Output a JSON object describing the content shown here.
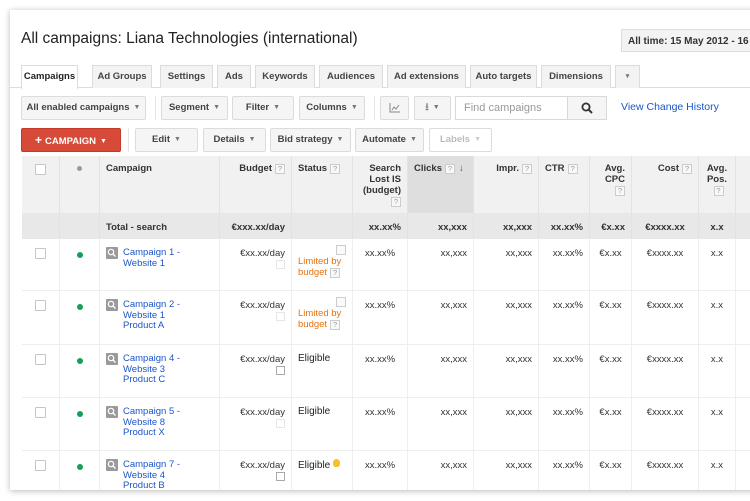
{
  "page": {
    "title": "All campaigns: Liana Technologies (international)",
    "date_range": "All time: 15 May 2012 - 16"
  },
  "tabs": [
    {
      "label": "Campaigns",
      "active": true
    },
    {
      "label": "Ad Groups"
    },
    {
      "label": "Settings"
    },
    {
      "label": "Ads"
    },
    {
      "label": "Keywords"
    },
    {
      "label": "Audiences"
    },
    {
      "label": "Ad extensions"
    },
    {
      "label": "Auto targets"
    },
    {
      "label": "Dimensions"
    },
    {
      "label": "▾",
      "icon": "more-tabs-caret-icon"
    }
  ],
  "toolbar1": {
    "filter_select": "All enabled campaigns",
    "segment": "Segment",
    "filter": "Filter",
    "columns": "Columns",
    "chart_icon": "line-chart-icon",
    "download_icon": "download-icon",
    "search_placeholder": "Find campaigns",
    "search_icon": "search-icon",
    "view_change_history": "View Change History"
  },
  "toolbar2": {
    "add_campaign": "CAMPAIGN",
    "edit": "Edit",
    "details": "Details",
    "bid_strategy": "Bid strategy",
    "automate": "Automate",
    "labels": "Labels"
  },
  "table": {
    "headers": {
      "campaign": "Campaign",
      "budget": "Budget",
      "status": "Status",
      "search_lost_is_1": "Search",
      "search_lost_is_2": "Lost IS",
      "search_lost_is_3": "(budget)",
      "clicks": "Clicks",
      "impr": "Impr.",
      "ctr": "CTR",
      "avg_cpc_1": "Avg.",
      "avg_cpc_2": "CPC",
      "cost": "Cost",
      "avg_pos_1": "Avg.",
      "avg_pos_2": "Pos.",
      "help": "?",
      "sort_arrow": "↓"
    },
    "total": {
      "label": "Total - search",
      "budget": "€xxx.xx/day",
      "search_lost_is": "xx.xx%",
      "clicks": "xx,xxx",
      "impr": "xx,xxx",
      "ctr": "xx.xx%",
      "avg_cpc": "€x.xx",
      "cost": "€xxxx.xx",
      "avg_pos": "x.x"
    },
    "rows": [
      {
        "name_1": "Campaign 1 -",
        "name_2": "Website 1",
        "name_3": "",
        "budget": "€xx.xx/day",
        "status_1": "Limited by",
        "status_2": "budget",
        "status_type": "limited",
        "search_lost_is": "xx.xx%",
        "clicks": "xx,xxx",
        "impr": "xx,xxx",
        "ctr": "xx.xx%",
        "avg_cpc": "€x.xx",
        "cost": "€xxxx.xx",
        "avg_pos": "x.x"
      },
      {
        "name_1": "Campaign 2 -",
        "name_2": "Website 1",
        "name_3": "Product A",
        "budget": "€xx.xx/day",
        "status_1": "Limited by",
        "status_2": "budget",
        "status_type": "limited",
        "search_lost_is": "xx.xx%",
        "clicks": "xx,xxx",
        "impr": "xx,xxx",
        "ctr": "xx.xx%",
        "avg_cpc": "€x.xx",
        "cost": "€xxxx.xx",
        "avg_pos": "x.x"
      },
      {
        "name_1": "Campaign 4 -",
        "name_2": "Website 3",
        "name_3": "Product C",
        "budget": "€xx.xx/day",
        "status_1": "Eligible",
        "status_2": "",
        "status_type": "eligible",
        "search_lost_is": "xx.xx%",
        "clicks": "xx,xxx",
        "impr": "xx,xxx",
        "ctr": "xx.xx%",
        "avg_cpc": "€x.xx",
        "cost": "€xxxx.xx",
        "avg_pos": "x.x"
      },
      {
        "name_1": "Campaign 5 -",
        "name_2": "Website 8",
        "name_3": "Product X",
        "budget": "€xx.xx/day",
        "status_1": "Eligible",
        "status_2": "",
        "status_type": "eligible",
        "search_lost_is": "xx.xx%",
        "clicks": "xx,xxx",
        "impr": "xx,xxx",
        "ctr": "xx.xx%",
        "avg_cpc": "€x.xx",
        "cost": "€xxxx.xx",
        "avg_pos": "x.x"
      },
      {
        "name_1": "Campaign 7 -",
        "name_2": "Website 4",
        "name_3": "Product B",
        "budget": "€xx.xx/day",
        "status_1": "Eligible",
        "status_2": "",
        "status_type": "eligible-bulb",
        "search_lost_is": "xx.xx%",
        "clicks": "xx,xxx",
        "impr": "xx,xxx",
        "ctr": "xx.xx%",
        "avg_cpc": "€x.xx",
        "cost": "€xxxx.xx",
        "avg_pos": "x.x"
      }
    ]
  },
  "colors": {
    "link": "#1a55c9",
    "primary_button": "#d84a38",
    "limited_status": "#e8710a",
    "enabled_dot": "#15a05a"
  }
}
